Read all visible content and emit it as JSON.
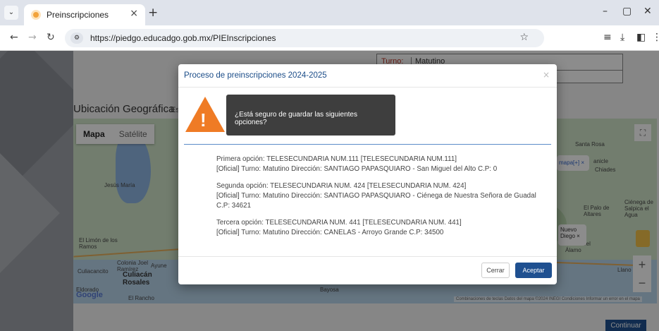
{
  "browser": {
    "tab_title": "Preinscripciones",
    "tab_close_icon": "×",
    "new_tab_icon": "+",
    "url": "https://piedgo.educadgo.gob.mx/PIEInscripciones",
    "window_controls": [
      "–",
      "▢",
      "✕"
    ]
  },
  "page": {
    "turno_label": "Turno:",
    "turno_value": "Matutino",
    "ubicacion_title": "Ubicación Geográfica",
    "ubicacion_extra": "Es",
    "continue_label": "Continuar"
  },
  "map": {
    "type_map": "Mapa",
    "type_satellite": "Satélite",
    "labels": {
      "jesus_maria": "Jesús María",
      "limon": "El Limón de los Ramos",
      "culiacancito": "Culiacancito",
      "colonia": "Colonia Joel Ramírez",
      "ayune": "Ayune",
      "culiacan": "Culiacán Rosales",
      "eldorado": "Eldorado",
      "rancho": "El Rancho",
      "bayosa": "Bayosa",
      "santa_rosa": "Santa Rosa",
      "chiades": "Chiades",
      "cienega": "Ciénega de Salpica el Agua",
      "el_palo": "El Palo de Altares",
      "nuevo_diego": "Nuevo Diego",
      "vacas": "Bajío de Vacas Del Álamo",
      "llano": "Llano B",
      "sanicle": "anicle"
    },
    "popup_text": "mapa",
    "popup2_text": "Nuevo Diego",
    "footer": "Combinaciones de teclas   Datos del mapa ©2024 INEGI   Condiciones   Informar un error en el mapa",
    "google": "Google"
  },
  "modal": {
    "title": "Proceso de preinscripciones 2024-2025",
    "close_icon": "×",
    "confirm_text": "¿Está seguro de guardar las siguientes opciones?",
    "options": [
      {
        "line1": "Primera opción:  TELESECUNDARIA NUM.111 [TELESECUNDARIA NUM.111]",
        "line2": "[Oficial]  Turno:  Matutino  Dirección:  SANTIAGO PAPASQUIARO - San Miguel del Alto C.P: 0"
      },
      {
        "line1": "Segunda opción:  TELESECUNDARIA NUM. 424 [TELESECUNDARIA NUM. 424]",
        "line2": "[Oficial]  Turno:  Matutino  Dirección:  SANTIAGO PAPASQUIARO - Ciénega de Nuestra Señora de Guadal C.P: 34621"
      },
      {
        "line1": "Tercera opción:  TELESECUNDARIA NUM. 441 [TELESECUNDARIA NUM. 441]",
        "line2": "[Oficial]  Turno:  Matutino  Dirección:  CANELAS - Arroyo Grande C.P: 34500"
      }
    ],
    "cancel_label": "Cerrar",
    "accept_label": "Aceptar"
  },
  "colors": {
    "accent": "#1f5090",
    "warning": "#ef7b25",
    "title_blue": "#1a4c88"
  }
}
